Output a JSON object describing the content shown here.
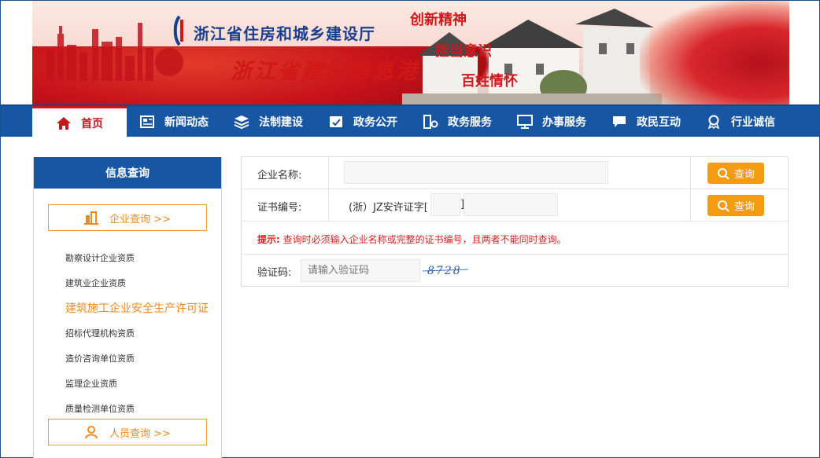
{
  "banner": {
    "org_name": "浙江省住房和城乡建设厅",
    "site_name": "浙江省建设信息港",
    "slogans": [
      "创新精神",
      "担当意识",
      "百姓情怀"
    ]
  },
  "nav": {
    "items": [
      {
        "label": "首页",
        "icon": "home-icon"
      },
      {
        "label": "新闻动态",
        "icon": "newspaper-icon"
      },
      {
        "label": "法制建设",
        "icon": "layers-icon"
      },
      {
        "label": "政务公开",
        "icon": "document-icon"
      },
      {
        "label": "政务服务",
        "icon": "server-gear-icon"
      },
      {
        "label": "办事服务",
        "icon": "monitor-icon"
      },
      {
        "label": "政民互动",
        "icon": "chat-icon"
      },
      {
        "label": "行业诚信",
        "icon": "award-icon"
      }
    ]
  },
  "sidebar": {
    "title": "信息查询",
    "company_query": "企业查询 >>",
    "person_query": "人员查询 >>",
    "links": [
      "勘察设计企业资质",
      "建筑业企业资质",
      "建筑施工企业安全生产许可证",
      "招标代理机构资质",
      "造价咨询单位资质",
      "监理企业资质",
      "质量检测单位资质"
    ]
  },
  "form": {
    "company_label": "企业名称:",
    "company_value": "",
    "cert_label": "证书编号:",
    "cert_prefix": "(浙）JZ安许证字[",
    "cert_bracket_close": "]",
    "cert_year_value": "",
    "cert_number_value": "",
    "query_label": "查询",
    "hint_title": "提示:",
    "hint_text": "查询时必须输入企业名称或完整的证书编号，且两者不能同时查询。",
    "captcha_label": "验证码:",
    "captcha_placeholder": "请输入验证码",
    "captcha_text": "8728"
  },
  "colors": {
    "nav_blue": "#1756a3",
    "accent_orange": "#f39c12",
    "active_red": "#c8161d",
    "hint_red": "#d62020"
  }
}
